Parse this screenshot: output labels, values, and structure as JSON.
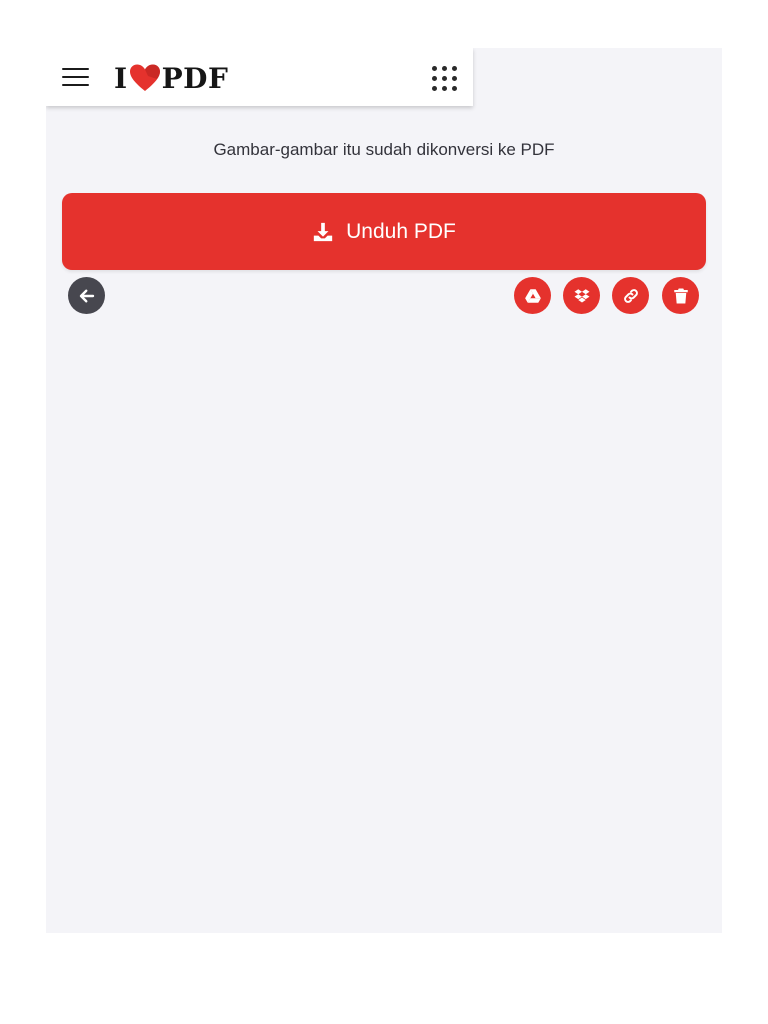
{
  "header": {
    "logo": {
      "prefix": "I",
      "suffix": "PDF",
      "heart_icon": "heart-icon"
    },
    "menu_icon": "hamburger-menu-icon",
    "apps_icon": "apps-grid-icon"
  },
  "main": {
    "status_text": "Gambar-gambar itu sudah dikonversi ke PDF",
    "download_button": {
      "label": "Unduh PDF",
      "icon": "download-icon"
    },
    "back_button": {
      "icon": "arrow-left-icon"
    },
    "actions": [
      {
        "name": "google-drive",
        "icon": "google-drive-icon"
      },
      {
        "name": "dropbox",
        "icon": "dropbox-icon"
      },
      {
        "name": "share-link",
        "icon": "link-icon"
      },
      {
        "name": "delete",
        "icon": "trash-icon"
      }
    ]
  },
  "colors": {
    "brand_red": "#e5322d",
    "dark_button": "#47474f",
    "background": "#f4f4f8",
    "text": "#33333b"
  }
}
